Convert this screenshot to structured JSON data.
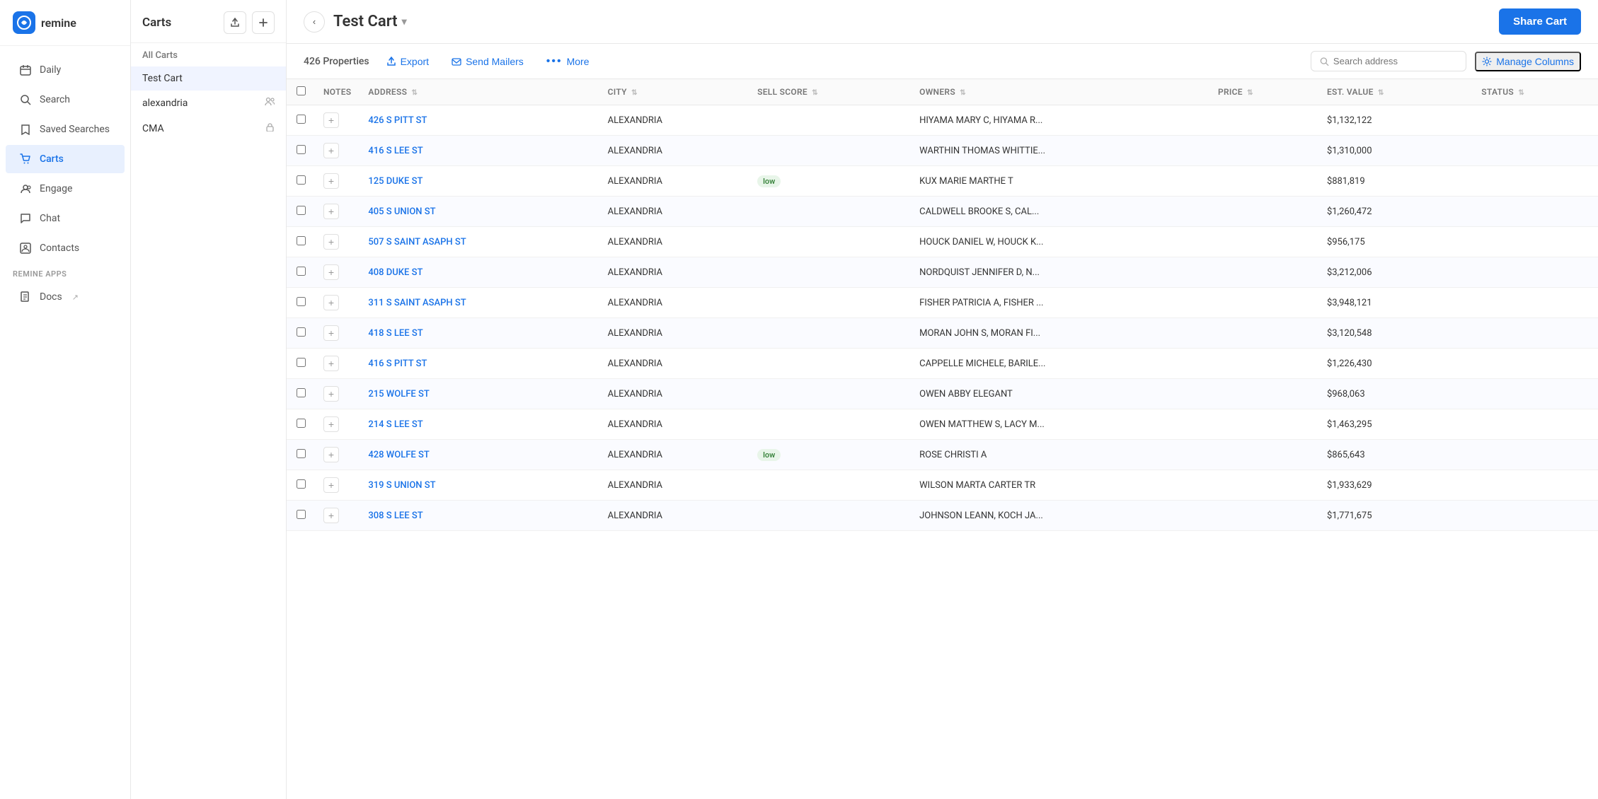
{
  "app": {
    "logo_text": "remine",
    "logo_initial": "r"
  },
  "sidebar": {
    "items": [
      {
        "id": "daily",
        "label": "Daily",
        "icon": "calendar"
      },
      {
        "id": "search",
        "label": "Search",
        "icon": "search"
      },
      {
        "id": "saved-searches",
        "label": "Saved Searches",
        "icon": "bookmark"
      },
      {
        "id": "carts",
        "label": "Carts",
        "icon": "cart",
        "active": true
      },
      {
        "id": "engage",
        "label": "Engage",
        "icon": "users"
      },
      {
        "id": "chat",
        "label": "Chat",
        "icon": "chat"
      },
      {
        "id": "contacts",
        "label": "Contacts",
        "icon": "contact"
      }
    ],
    "section_label": "REMINE APPS",
    "docs": {
      "label": "Docs",
      "icon": "external-link"
    }
  },
  "carts_panel": {
    "title": "Carts",
    "all_label": "All Carts",
    "items": [
      {
        "id": "test-cart",
        "name": "Test Cart",
        "active": true,
        "icon": ""
      },
      {
        "id": "alexandria",
        "name": "alexandria",
        "icon": "users"
      },
      {
        "id": "cma",
        "name": "CMA",
        "icon": "lock"
      }
    ]
  },
  "content": {
    "cart_name": "Test Cart",
    "share_button": "Share Cart",
    "properties_count": "426 Properties",
    "toolbar_buttons": {
      "export": "Export",
      "send_mailers": "Send Mailers",
      "more": "More"
    },
    "search_placeholder": "Search address",
    "manage_columns": "Manage Columns"
  },
  "table": {
    "columns": [
      {
        "id": "notes",
        "label": "NOTES"
      },
      {
        "id": "address",
        "label": "ADDRESS",
        "sortable": true
      },
      {
        "id": "city",
        "label": "CITY",
        "sortable": true
      },
      {
        "id": "sell_score",
        "label": "SELL SCORE",
        "sortable": true
      },
      {
        "id": "owners",
        "label": "OWNERS",
        "sortable": true
      },
      {
        "id": "price",
        "label": "PRICE",
        "sortable": true
      },
      {
        "id": "est_value",
        "label": "EST. VALUE",
        "sortable": true
      },
      {
        "id": "status",
        "label": "STATUS",
        "sortable": true
      }
    ],
    "rows": [
      {
        "address": "426 S PITT ST",
        "city": "ALEXANDRIA",
        "sell_score": "",
        "owners": "HIYAMA MARY C, HIYAMA R...",
        "price": "",
        "est_value": "$1,132,122",
        "status": ""
      },
      {
        "address": "416 S LEE ST",
        "city": "ALEXANDRIA",
        "sell_score": "",
        "owners": "WARTHIN THOMAS WHITTIE...",
        "price": "",
        "est_value": "$1,310,000",
        "status": ""
      },
      {
        "address": "125 DUKE ST",
        "city": "ALEXANDRIA",
        "sell_score": "low",
        "owners": "KUX MARIE MARTHE T",
        "price": "",
        "est_value": "$881,819",
        "status": ""
      },
      {
        "address": "405 S UNION ST",
        "city": "ALEXANDRIA",
        "sell_score": "",
        "owners": "CALDWELL BROOKE S, CAL...",
        "price": "",
        "est_value": "$1,260,472",
        "status": ""
      },
      {
        "address": "507 S SAINT ASAPH ST",
        "city": "ALEXANDRIA",
        "sell_score": "",
        "owners": "HOUCK DANIEL W, HOUCK K...",
        "price": "",
        "est_value": "$956,175",
        "status": ""
      },
      {
        "address": "408 DUKE ST",
        "city": "ALEXANDRIA",
        "sell_score": "",
        "owners": "NORDQUIST JENNIFER D, N...",
        "price": "",
        "est_value": "$3,212,006",
        "status": ""
      },
      {
        "address": "311 S SAINT ASAPH ST",
        "city": "ALEXANDRIA",
        "sell_score": "",
        "owners": "FISHER PATRICIA A, FISHER ...",
        "price": "",
        "est_value": "$3,948,121",
        "status": ""
      },
      {
        "address": "418 S LEE ST",
        "city": "ALEXANDRIA",
        "sell_score": "",
        "owners": "MORAN JOHN S, MORAN FI...",
        "price": "",
        "est_value": "$3,120,548",
        "status": ""
      },
      {
        "address": "416 S PITT ST",
        "city": "ALEXANDRIA",
        "sell_score": "",
        "owners": "CAPPELLE MICHELE, BARILE...",
        "price": "",
        "est_value": "$1,226,430",
        "status": ""
      },
      {
        "address": "215 WOLFE ST",
        "city": "ALEXANDRIA",
        "sell_score": "",
        "owners": "OWEN ABBY ELEGANT",
        "price": "",
        "est_value": "$968,063",
        "status": ""
      },
      {
        "address": "214 S LEE ST",
        "city": "ALEXANDRIA",
        "sell_score": "",
        "owners": "OWEN MATTHEW S, LACY M...",
        "price": "",
        "est_value": "$1,463,295",
        "status": ""
      },
      {
        "address": "428 WOLFE ST",
        "city": "ALEXANDRIA",
        "sell_score": "low",
        "owners": "ROSE CHRISTI A",
        "price": "",
        "est_value": "$865,643",
        "status": ""
      },
      {
        "address": "319 S UNION ST",
        "city": "ALEXANDRIA",
        "sell_score": "",
        "owners": "WILSON MARTA CARTER TR",
        "price": "",
        "est_value": "$1,933,629",
        "status": ""
      },
      {
        "address": "308 S LEE ST",
        "city": "ALEXANDRIA",
        "sell_score": "",
        "owners": "JOHNSON LEANN, KOCH JA...",
        "price": "",
        "est_value": "$1,771,675",
        "status": ""
      }
    ]
  },
  "icons": {
    "back": "‹",
    "chevron_down": "▾",
    "export": "↑",
    "mailers": "✉",
    "more": "•••",
    "search": "🔍",
    "gear": "⚙",
    "plus": "+",
    "upload": "↑",
    "external": "↗",
    "users": "👥",
    "lock": "🔒",
    "sort": "⇅"
  },
  "colors": {
    "accent": "#1a73e8",
    "brand": "#1a73e8"
  }
}
